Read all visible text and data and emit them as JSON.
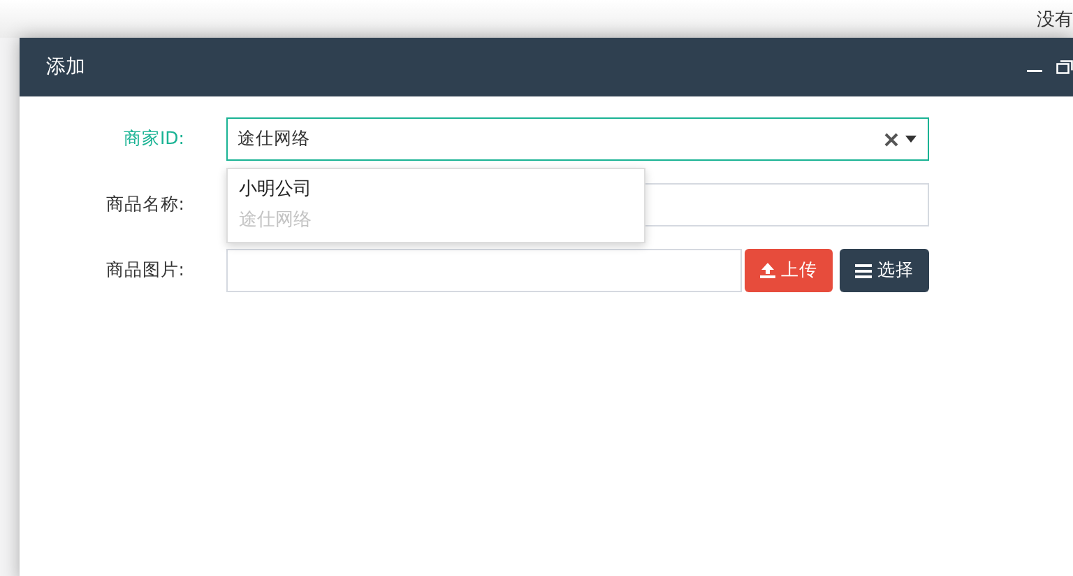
{
  "page": {
    "header_text": "没有"
  },
  "dialog": {
    "title": "添加",
    "form": [
      {
        "kind": "select",
        "label": "商家ID:",
        "focused": true,
        "value": "途仕网络",
        "options": [
          {
            "label": "小明公司",
            "disabled": false
          },
          {
            "label": "途仕网络",
            "disabled": true
          }
        ]
      },
      {
        "kind": "text",
        "label": "商品名称:",
        "focused": false
      },
      {
        "kind": "upload",
        "label": "商品图片:",
        "focused": false,
        "buttons": [
          {
            "kind": "upload",
            "label": "上传"
          },
          {
            "kind": "choose",
            "label": "选择"
          }
        ]
      }
    ]
  }
}
